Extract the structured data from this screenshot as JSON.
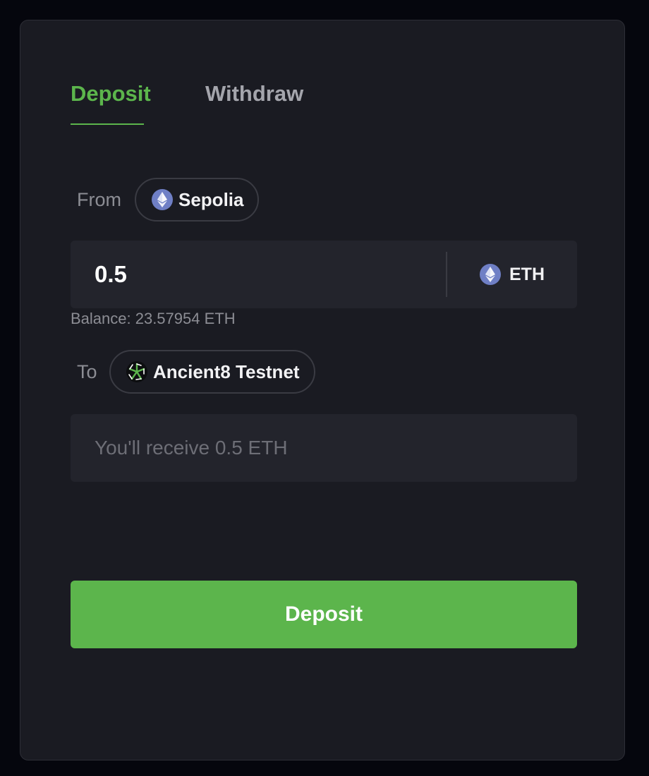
{
  "tabs": {
    "deposit_label": "Deposit",
    "withdraw_label": "Withdraw",
    "active": "deposit"
  },
  "from": {
    "label": "From",
    "chain": "Sepolia",
    "chain_icon": "ethereum-icon"
  },
  "amount": {
    "value": "0.5",
    "token": "ETH",
    "token_icon": "ethereum-icon"
  },
  "balance": {
    "text": "Balance: 23.57954 ETH"
  },
  "to": {
    "label": "To",
    "chain": "Ancient8 Testnet",
    "chain_icon": "ancient8-icon"
  },
  "receive": {
    "text": "You'll receive 0.5 ETH"
  },
  "action": {
    "label": "Deposit"
  },
  "colors": {
    "accent": "#5cb54c",
    "tab_active": "#5cb54c",
    "tab_inactive": "#a4a5ac",
    "card_bg": "#1a1b22",
    "page_bg": "#05060d",
    "field_bg": "#23242c",
    "eth_icon": "#6f7fc5"
  }
}
